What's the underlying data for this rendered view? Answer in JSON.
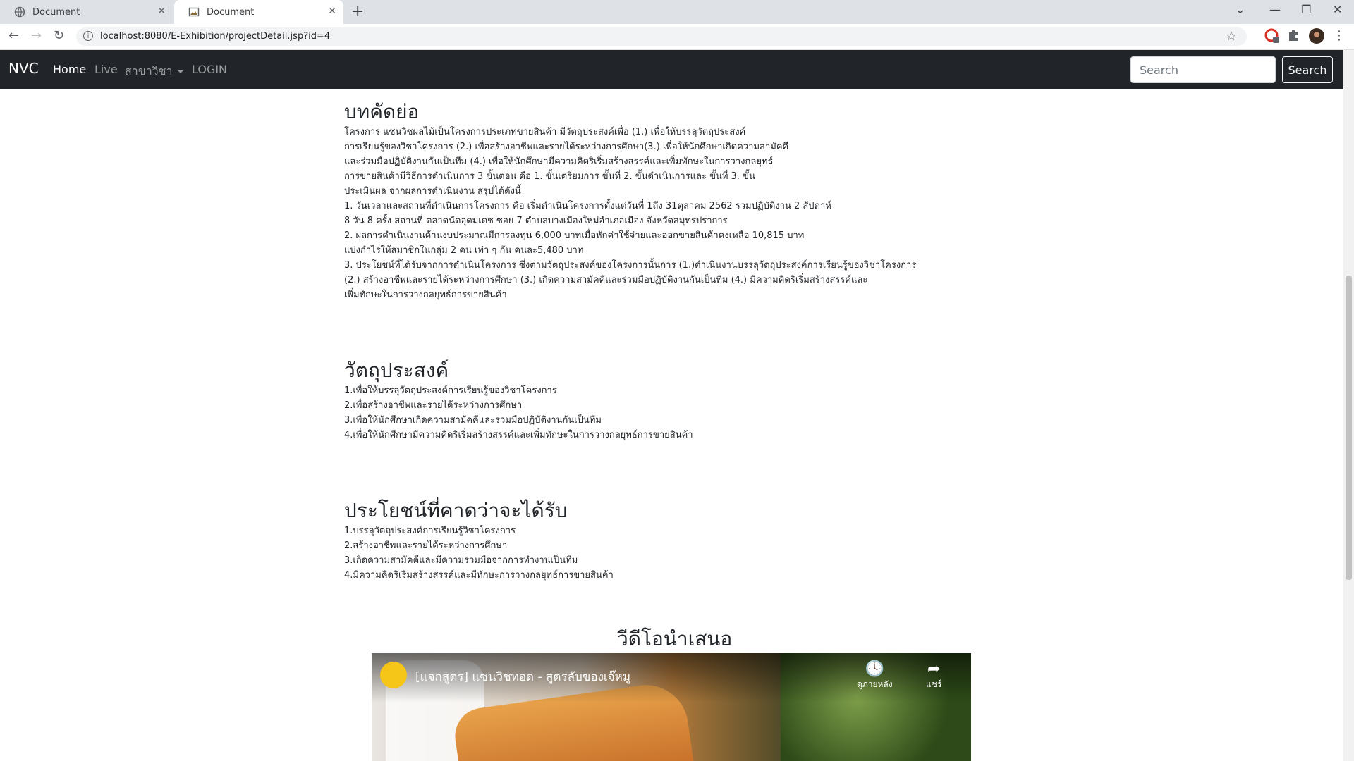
{
  "browser": {
    "tabs": [
      {
        "title": "Document",
        "active": false
      },
      {
        "title": "Document",
        "active": true
      }
    ],
    "url": "localhost:8080/E-Exhibition/projectDetail.jsp?id=4"
  },
  "navbar": {
    "brand": "NVC",
    "links": [
      {
        "label": "Home",
        "active": true
      },
      {
        "label": "Live",
        "active": false
      },
      {
        "label": "สาขาวิชา",
        "active": false
      },
      {
        "label": "LOGIN",
        "active": false
      }
    ],
    "search_placeholder": "Search",
    "search_button": "Search"
  },
  "abstract": {
    "heading": "บทคัดย่อ",
    "lines": [
      " โครงการ แซนวิชผลไม้เป็นโครงการประเภทขายสินค้า มีวัตถุประสงค์เพื่อ (1.) เพื่อให้บรรลุวัตถุประสงค์",
      "การเรียนรู้ของวิชาโครงการ (2.) เพื่อสร้างอาชีพและรายได้ระหว่างการศึกษา(3.) เพื่อให้นักศึกษาเกิดความสามัคคี",
      "และร่วมมือปฏิบัติงานกันเป็นทีม (4.) เพื่อให้นักศึกษามีความคิดริเริ่มสร้างสรรค์และเพิ่มทักษะในการวางกลยุทธ์",
      "การขายสินค้ามีวิธีการดำเนินการ 3 ขั้นตอน คือ 1. ขั้นเตรียมการ ขั้นที่ 2. ขั้นดำเนินการและ ขั้นที่ 3. ขั้น",
      "ประเมินผล จากผลการดำเนินงาน สรุปได้ดังนี้",
      "1. วันเวลาและสถานที่ดำเนินการโครงการ คือ เริ่มดำเนินโครงการตั้งแต่วันที่ 1ถึง 31ตุลาคม 2562 รวมปฏิบัติงาน 2 สัปดาห์",
      "8 วัน 8 ครั้ง สถานที่ ตลาดนัดอุดมเดช ซอย 7 ตำบลบางเมืองใหม่อำเภอเมือง จังหวัดสมุทรปราการ",
      "2. ผลการดำเนินงานด้านงบประมาณมีการลงทุน 6,000 บาทเมื่อหักค่าใช้จ่ายและออกขายสินค้าคงเหลือ 10,815 บาท",
      "แบ่งกำไรให้สมาชิกในกลุ่ม 2 คน เท่า ๆ กัน คนละ5,480 บาท",
      "3. ประโยชน์ที่ได้รับจากการดำเนินโครงการ ซึ่งตามวัตถุประสงค์ของโครงการนั้นการ (1.)ดำเนินงานบรรลุวัตถุประสงค์การเรียนรู้ของวิชาโครงการ",
      "(2.) สร้างอาชีพและรายได้ระหว่างการศึกษา (3.) เกิดความสามัคคีและร่วมมือปฏิบัติงานกันเป็นทีม (4.) มีความคิดริเริ่มสร้างสรรค์และ",
      "เพิ่มทักษะในการวางกลยุทธ์การขายสินค้า"
    ]
  },
  "objectives": {
    "heading": "วัตถุประสงค์",
    "lines": [
      "1.เพื่อให้บรรลุวัตถุประสงค์การเรียนรู้ของวิชาโครงการ",
      "2.เพื่อสร้างอาชีพและรายได้ระหว่างการศึกษา",
      "3.เพื่อให้นักศึกษาเกิดความสามัคคีและร่วมมือปฏิบัติงานกันเป็นทีม",
      "4.เพื่อให้นักศึกษามีความคิดริเริ่มสร้างสรรค์และเพิ่มทักษะในการวางกลยุทธ์การขายสินค้า"
    ]
  },
  "benefits": {
    "heading": "ประโยชน์ที่คาดว่าจะได้รับ",
    "lines": [
      "1.บรรลุวัตถุประสงค์การเรียนรู้วิชาโครงการ",
      "2.สร้างอาชีพและรายได้ระหว่างการศึกษา",
      "3.เกิดความสามัคคีและมีความร่วมมือจากการทำงานเป็นทีม",
      "4.มีความคิดริเริ่มสร้างสรรค์และมีทักษะการวางกลยุทธ์การขายสินค้า"
    ]
  },
  "video": {
    "heading": "วีดีโอนำเสนอ",
    "title": "[แจกสูตร] แซนวิชทอด - สูตรลับของเจ๊หมู",
    "watch_later": "ดูภายหลัง",
    "share": "แชร์"
  }
}
